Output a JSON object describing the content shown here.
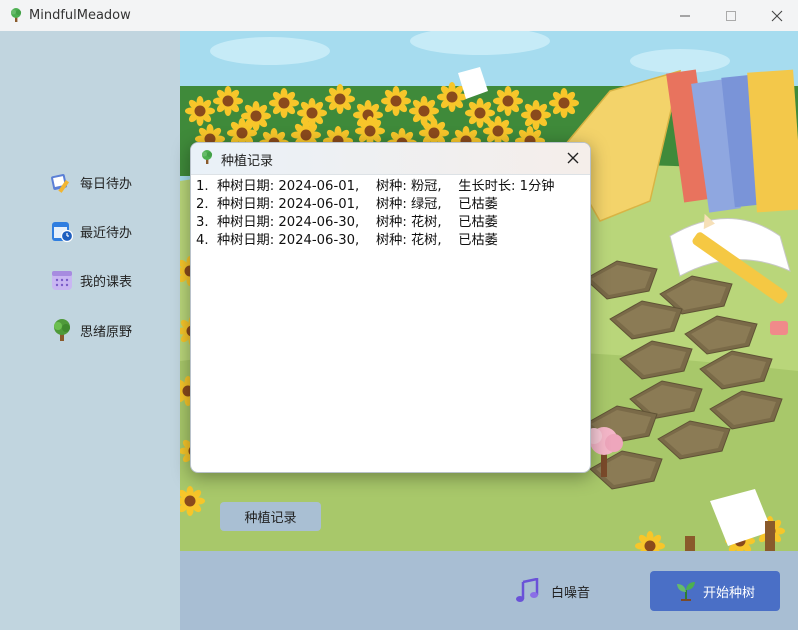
{
  "window": {
    "title": "MindfulMeadow"
  },
  "sidebar": {
    "items": [
      {
        "label": "每日待办",
        "icon": "notepad-pencil-icon"
      },
      {
        "label": "最近待办",
        "icon": "calendar-clock-icon"
      },
      {
        "label": "我的课表",
        "icon": "calendar-icon"
      },
      {
        "label": "思绪原野",
        "icon": "tree-icon"
      }
    ]
  },
  "dialog": {
    "title": "种植记录",
    "records": [
      "1.  种树日期: 2024-06-01,    树种: 粉冠,    生长时长: 1分钟",
      "2.  种树日期: 2024-06-01,    树种: 绿冠,    已枯萎",
      "3.  种树日期: 2024-06-30,    树种: 花树,    已枯萎",
      "4.  种树日期: 2024-06-30,    树种: 花树,    已枯萎"
    ]
  },
  "main": {
    "plant_record_label": "种植记录",
    "white_noise_label": "白噪音",
    "start_label": "开始种树"
  },
  "colors": {
    "sidebar_bg": "#c1d5df",
    "bottombar_bg": "#a8bed3",
    "accent": "#4a6fc6",
    "sky": "#a6dcef",
    "grass": "#b9d67a"
  }
}
